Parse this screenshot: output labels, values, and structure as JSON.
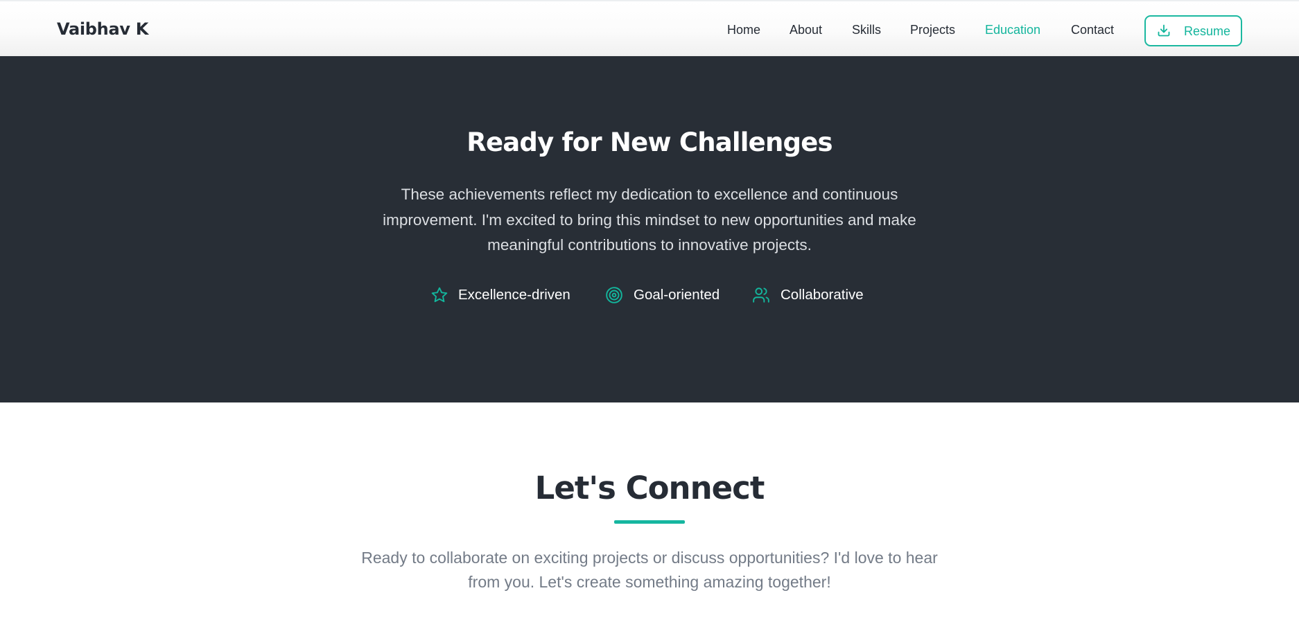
{
  "nav": {
    "brand": "Vaibhav K",
    "links": [
      "Home",
      "About",
      "Skills",
      "Projects",
      "Education",
      "Contact"
    ],
    "active_link": "Education",
    "resume_label": "Resume",
    "resume_icon": "download-icon"
  },
  "hero": {
    "title": "Ready for New Challenges",
    "text": "These achievements reflect my dedication to excellence and continuous improvement. I'm excited to bring this mindset to new opportunities and make meaningful contributions to innovative projects.",
    "traits": [
      {
        "label": "Excellence-driven",
        "icon": "star-icon"
      },
      {
        "label": "Goal-oriented",
        "icon": "target-icon"
      },
      {
        "label": "Collaborative",
        "icon": "users-icon"
      }
    ]
  },
  "connect": {
    "title": "Let's Connect",
    "text": "Ready to collaborate on exciting projects or discuss opportunities? I'd love to hear from you. Let's create something amazing together!"
  },
  "colors": {
    "accent": "#13b59c",
    "hero_bg": "#282e36",
    "text_dark": "#262c35",
    "text_muted": "#737b87"
  }
}
